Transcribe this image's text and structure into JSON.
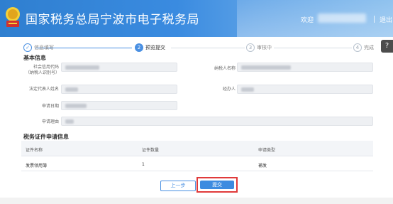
{
  "header": {
    "title": "国家税务总局宁波市电子税务局",
    "user_prefix": "欢迎",
    "logout": "退出",
    "colors": {
      "header_bg": "#2f7fd0",
      "accent": "#4a90e2",
      "highlight_border": "#e03a3a"
    }
  },
  "steps": [
    {
      "num": "✓",
      "label": "信息填写",
      "state": "done"
    },
    {
      "num": "2",
      "label": "预览提交",
      "state": "active"
    },
    {
      "num": "3",
      "label": "审核中",
      "state": "pending"
    },
    {
      "num": "4",
      "label": "完成",
      "state": "pending"
    }
  ],
  "help_icon": "?",
  "basic": {
    "title": "基本信息",
    "fields": {
      "credit_code": "社会信用代码（纳税人识别号）",
      "taxpayer_name": "纳税人名称",
      "legal_rep": "法定代表人姓名",
      "handler": "经办人",
      "apply_date": "申请日期",
      "reason": "申请理由"
    }
  },
  "cert": {
    "title": "税务证件申请信息",
    "headers": [
      "证件名称",
      "证件数量",
      "申请类型"
    ],
    "rows": [
      [
        "发票领用簿",
        "1",
        "補发"
      ]
    ]
  },
  "buttons": {
    "prev": "上一步",
    "submit": "提交"
  }
}
